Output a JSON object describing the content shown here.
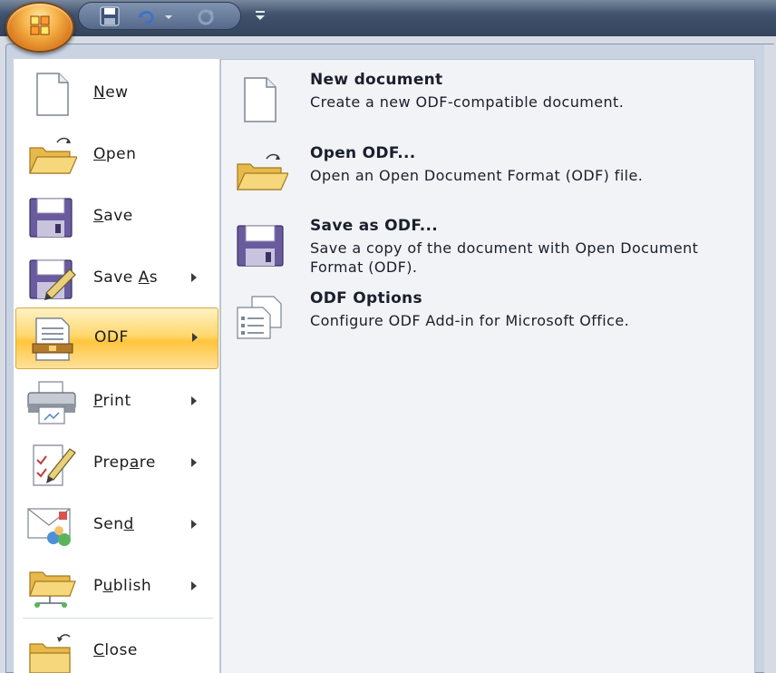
{
  "left_menu": {
    "items": [
      {
        "name": "new",
        "label_pre": "",
        "label_ul": "N",
        "label_post": "ew",
        "has_submenu": false,
        "icon": "new-document-icon"
      },
      {
        "name": "open",
        "label_pre": "",
        "label_ul": "O",
        "label_post": "pen",
        "has_submenu": false,
        "icon": "open-folder-icon"
      },
      {
        "name": "save",
        "label_pre": "",
        "label_ul": "S",
        "label_post": "ave",
        "has_submenu": false,
        "icon": "floppy-disk-icon"
      },
      {
        "name": "save-as",
        "label_pre": "Save ",
        "label_ul": "A",
        "label_post": "s",
        "has_submenu": true,
        "icon": "save-as-icon"
      },
      {
        "name": "odf",
        "label_pre": "ODF",
        "label_ul": "",
        "label_post": "",
        "has_submenu": true,
        "icon": "odf-document-icon"
      },
      {
        "name": "print",
        "label_pre": "",
        "label_ul": "P",
        "label_post": "rint",
        "has_submenu": true,
        "icon": "printer-icon"
      },
      {
        "name": "prepare",
        "label_pre": "Prep",
        "label_ul": "a",
        "label_post": "re",
        "has_submenu": true,
        "icon": "prepare-pen-icon"
      },
      {
        "name": "send",
        "label_pre": "Sen",
        "label_ul": "d",
        "label_post": "",
        "has_submenu": true,
        "icon": "send-mail-icon"
      },
      {
        "name": "publish",
        "label_pre": "P",
        "label_ul": "u",
        "label_post": "blish",
        "has_submenu": true,
        "icon": "publish-folder-icon"
      },
      {
        "name": "close",
        "label_pre": "",
        "label_ul": "C",
        "label_post": "lose",
        "has_submenu": false,
        "icon": "close-folder-icon"
      }
    ],
    "active_item": "ODF"
  },
  "odf_submenu": {
    "entries": [
      {
        "title": "New document",
        "description": "Create a new ODF-compatible document.",
        "icon": "new-document-icon"
      },
      {
        "title": "Open ODF...",
        "description": "Open an Open Document Format (ODF) file.",
        "icon": "open-folder-icon"
      },
      {
        "title": "Save as ODF...",
        "description": "Save a copy of the document with Open Document Format (ODF).",
        "icon": "floppy-disk-icon"
      },
      {
        "title": "ODF Options",
        "description": "Configure ODF Add-in for Microsoft Office.",
        "icon": "options-document-icon"
      }
    ]
  },
  "quick_access_toolbar": {
    "buttons": [
      "save-icon",
      "undo-icon",
      "undo-dropdown-icon",
      "redo-icon",
      "customize-icon"
    ]
  },
  "colors": {
    "title_bar": "#3f506b",
    "active_highlight": "#ffc53e",
    "office_button": "#f7b54a"
  }
}
